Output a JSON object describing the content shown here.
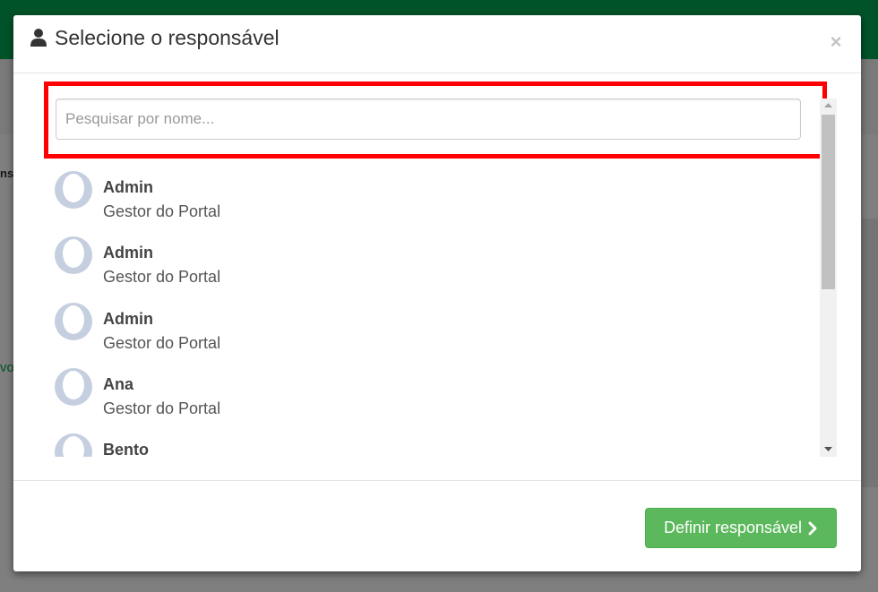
{
  "background": {
    "text_left_top": "ns",
    "text_left_mid": "vo"
  },
  "modal": {
    "title": "Selecione o responsável",
    "title_icon": "user-icon",
    "close_label": "×"
  },
  "search": {
    "placeholder": "Pesquisar por nome...",
    "value": ""
  },
  "users": [
    {
      "name": "Admin",
      "role": "Gestor do Portal"
    },
    {
      "name": "Admin",
      "role": "Gestor do Portal"
    },
    {
      "name": "Admin",
      "role": "Gestor do Portal"
    },
    {
      "name": "Ana",
      "role": "Gestor do Portal"
    },
    {
      "name": "Bento",
      "role": ""
    }
  ],
  "footer": {
    "define_label": "Definir responsável",
    "define_icon": "chevron-right-icon"
  },
  "colors": {
    "brand_green": "#00a651",
    "button_green": "#5cb85c",
    "highlight_red": "#ff0000",
    "avatar": "#c5cfe0"
  }
}
